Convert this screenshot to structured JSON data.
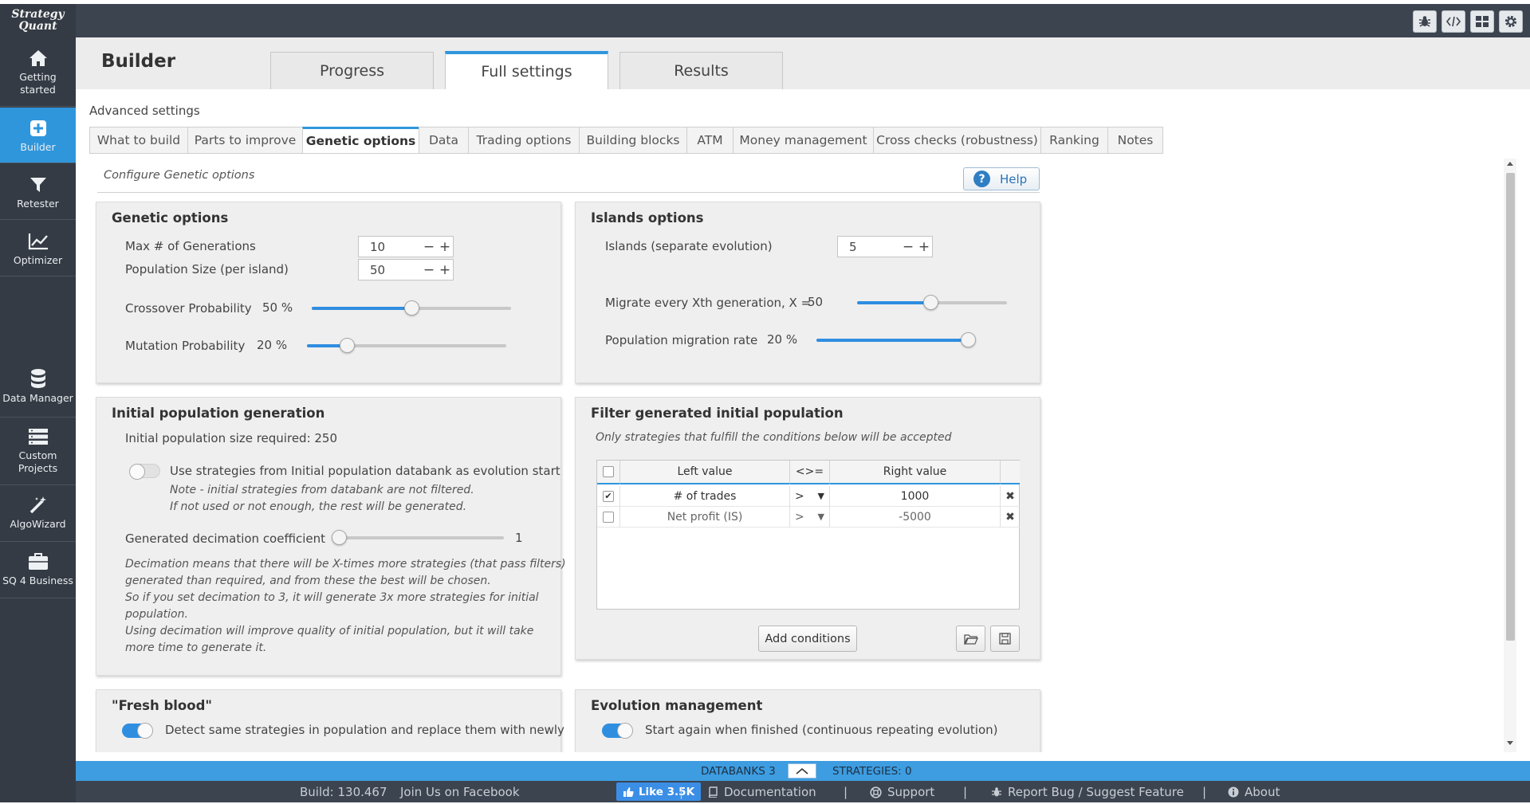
{
  "app": {
    "logo_line1": "Strategy",
    "logo_line2": "Quant"
  },
  "sidebar": {
    "items": [
      {
        "label": "Getting started",
        "icon": "home-icon"
      },
      {
        "label": "Builder",
        "icon": "plus-square-icon"
      },
      {
        "label": "Retester",
        "icon": "filter-icon"
      },
      {
        "label": "Optimizer",
        "icon": "chart-line-icon"
      },
      {
        "label": "Data Manager",
        "icon": "database-icon"
      },
      {
        "label": "Custom Projects",
        "icon": "list-icon"
      },
      {
        "label": "AlgoWizard",
        "icon": "magic-wand-icon"
      },
      {
        "label": "SQ 4 Business",
        "icon": "briefcase-icon"
      }
    ]
  },
  "top_icons": [
    "bug-icon",
    "code-icon",
    "grid-icon",
    "gear-icon"
  ],
  "header": {
    "title": "Builder",
    "tabs": [
      "Progress",
      "Full settings",
      "Results"
    ],
    "active_tab": "Full settings"
  },
  "advanced_settings": "Advanced settings",
  "sub_tabs": [
    "What to build",
    "Parts to improve",
    "Genetic options",
    "Data",
    "Trading options",
    "Building blocks",
    "ATM",
    "Money management",
    "Cross checks (robustness)",
    "Ranking",
    "Notes"
  ],
  "active_sub_tab": "Genetic options",
  "config_title": "Configure Genetic options",
  "help_label": "Help",
  "genetic": {
    "title": "Genetic options",
    "max_gen_label": "Max # of Generations",
    "max_gen_value": "10",
    "pop_size_label": "Population Size (per island)",
    "pop_size_value": "50",
    "crossover_label": "Crossover Probability",
    "crossover_value": "50 %",
    "crossover_level": 0.5,
    "mutation_label": "Mutation Probability",
    "mutation_value": "20 %",
    "mutation_level": 0.2
  },
  "islands": {
    "title": "Islands options",
    "islands_label": "Islands (separate evolution)",
    "islands_value": "5",
    "migrate_label": "Migrate every Xth generation, X =",
    "migrate_value": "50",
    "migrate_level": 0.49,
    "rate_label": "Population migration rate",
    "rate_value": "20 %",
    "rate_level": 1.0
  },
  "initial": {
    "title": "Initial population generation",
    "size_required": "Initial population size required: 250",
    "use_strategies": "Use strategies from Initial population databank as evolution start",
    "note1": "Note - initial strategies from databank are not filtered.",
    "note2": "If not used or not enough, the rest will be generated.",
    "decimation_label": "Generated decimation coefficient",
    "decimation_value": "1",
    "decimation_level": 0.0,
    "desc1": "Decimation means that there will be X-times more strategies (that pass filters)",
    "desc2": "generated than required, and from these the best will be chosen.",
    "desc3": "So if you set decimation to 3, it will generate 3x more strategies for initial",
    "desc4": "population.",
    "desc5": "Using decimation will improve quality of initial population, but it will take",
    "desc6": "more time to generate it."
  },
  "filter": {
    "title": "Filter generated initial population",
    "subtitle": "Only strategies that fulfill the conditions below will be accepted",
    "headers": [
      "Left value",
      "<>=",
      "Right value"
    ],
    "rows": [
      {
        "checked": true,
        "left": "# of trades",
        "op": ">",
        "right": "1000"
      },
      {
        "checked": false,
        "left": "Net profit (IS)",
        "op": ">",
        "right": "-5000"
      }
    ],
    "add_label": "Add conditions"
  },
  "fresh": {
    "title": "\"Fresh blood\"",
    "text": "Detect same strategies in population and replace them with newly"
  },
  "evolution": {
    "title": "Evolution management",
    "text": "Start again when finished (continuous repeating evolution)"
  },
  "databanks": {
    "label": "DATABANKS 3",
    "strategies": "STRATEGIES: 0"
  },
  "footer": {
    "build": "Build: 130.467",
    "facebook": "Join Us on Facebook",
    "like": "Like 3.5K",
    "documentation": "Documentation",
    "support": "Support",
    "report": "Report Bug / Suggest Feature",
    "about": "About"
  },
  "colors": {
    "accent": "#2f96dc",
    "sidebar": "#353b44",
    "topbar": "#3c4450"
  }
}
